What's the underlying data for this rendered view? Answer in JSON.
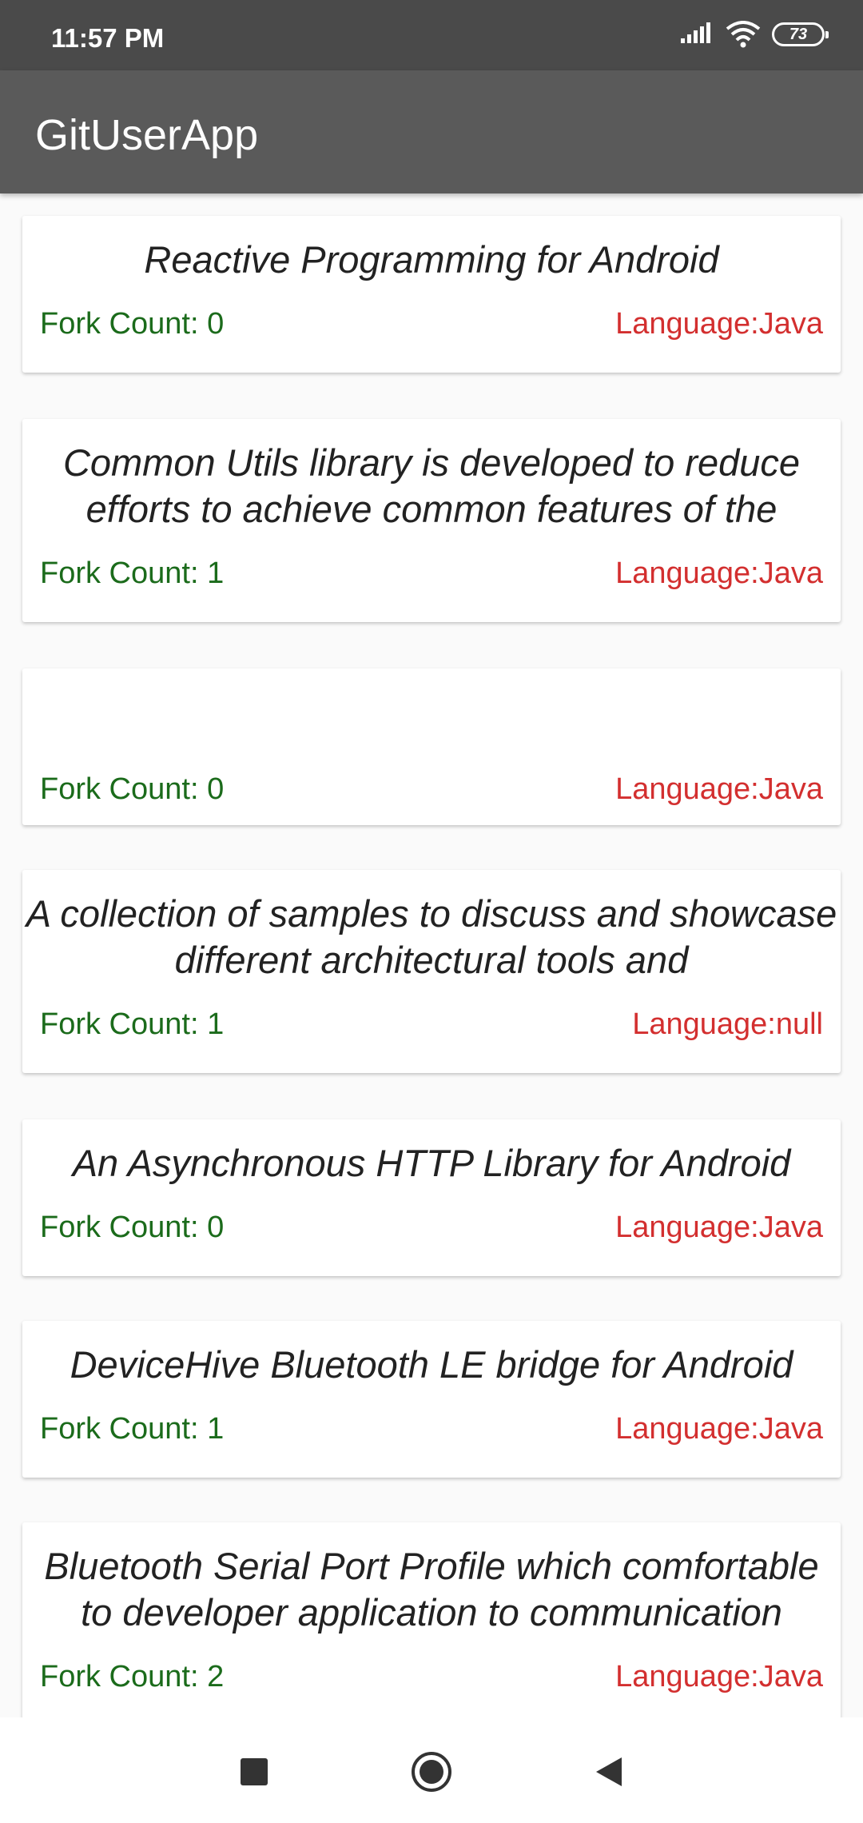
{
  "status_bar": {
    "time": "11:57 PM",
    "battery_level": "73",
    "icons": [
      "signal-icon",
      "wifi-icon",
      "battery-icon"
    ]
  },
  "app_bar": {
    "title": "GitUserApp"
  },
  "repositories": [
    {
      "description": "Reactive Programming for Android",
      "fork_count": "Fork Count: 0",
      "language": "Language:Java"
    },
    {
      "description": "Common Utils library is developed to reduce efforts to achieve common features of the",
      "fork_count": "Fork Count: 1",
      "language": "Language:Java"
    },
    {
      "description": "",
      "fork_count": "Fork Count: 0",
      "language": "Language:Java"
    },
    {
      "description": "A collection of samples to discuss and showcase different architectural tools and",
      "fork_count": "Fork Count: 1",
      "language": "Language:null"
    },
    {
      "description": "An Asynchronous HTTP Library for Android",
      "fork_count": "Fork Count: 0",
      "language": "Language:Java"
    },
    {
      "description": "DeviceHive Bluetooth LE bridge for Android",
      "fork_count": "Fork Count: 1",
      "language": "Language:Java"
    },
    {
      "description": "Bluetooth Serial Port Profile which comfortable to developer application to communication",
      "fork_count": "Fork Count: 2",
      "language": "Language:Java"
    }
  ],
  "nav_bar": {
    "icons": [
      "recents-square-icon",
      "home-circle-icon",
      "back-triangle-icon"
    ]
  },
  "colors": {
    "fork_text": "#1b6b1b",
    "language_text": "#d32f2f",
    "app_bar": "#5a5a5a",
    "status_bar": "#4a4a4a"
  }
}
